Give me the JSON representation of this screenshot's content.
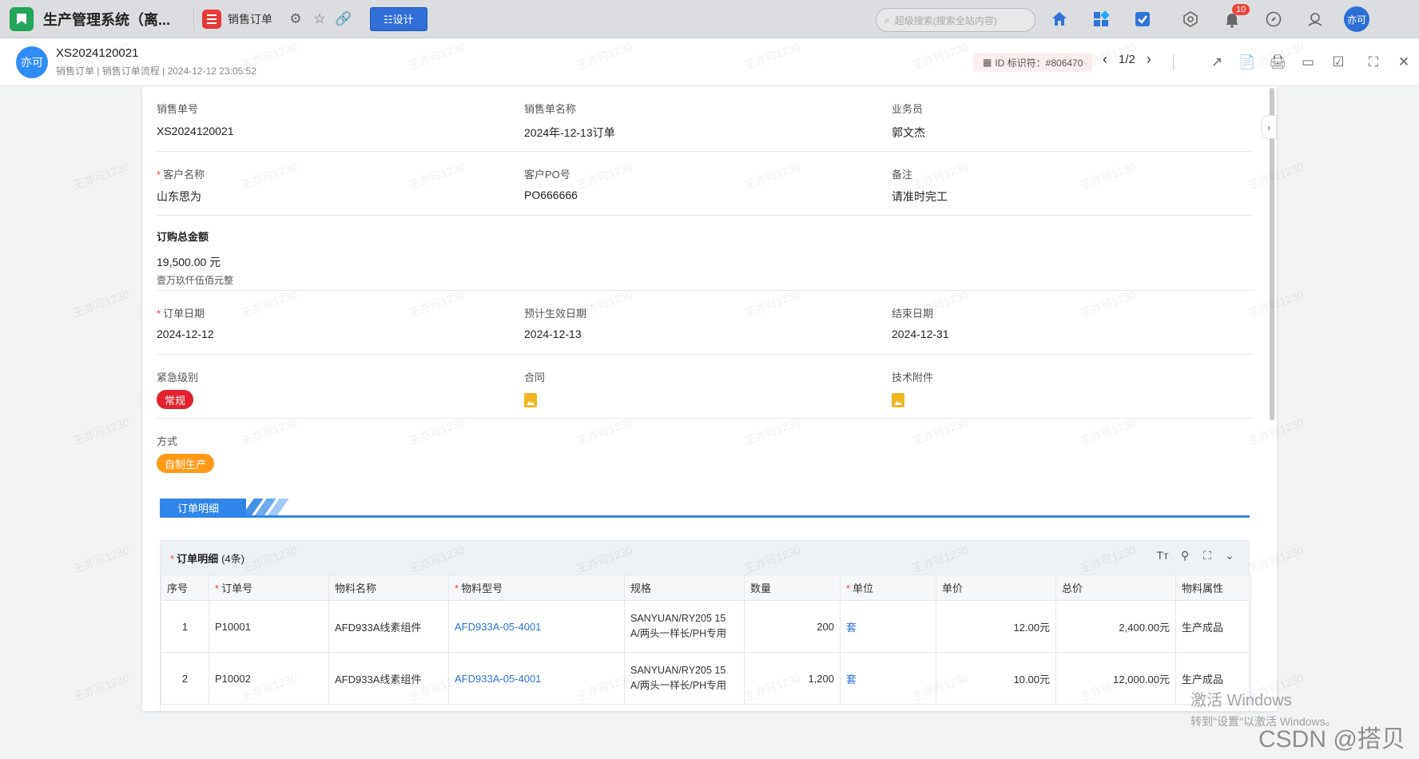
{
  "app": {
    "title": "生产管理系统（离...",
    "tab_title": "销售订单",
    "design_label": "☷设计",
    "search_placeholder": "超级搜索(搜索全站内容)",
    "notification_count": "10",
    "user_avatar": "亦可"
  },
  "record": {
    "avatar": "亦可",
    "title": "XS2024120021",
    "subtitle": "销售订单 | 销售订单流程 | 2024-12-12 23:05:52",
    "id_tag": "ID 标识符：#806470",
    "pager": "1/2"
  },
  "fields": {
    "order_no": {
      "label": "销售单号",
      "value": "XS2024120021"
    },
    "order_name": {
      "label": "销售单名称",
      "value": "2024年-12-13订单"
    },
    "salesman": {
      "label": "业务员",
      "value": "郭文杰"
    },
    "customer": {
      "label": "客户名称",
      "value": "山东思为"
    },
    "customer_po": {
      "label": "客户PO号",
      "value": "PO666666"
    },
    "remark": {
      "label": "备注",
      "value": "请准时完工"
    },
    "total": {
      "label": "订购总金额",
      "value": "19,500.00 元",
      "words": "壹万玖仟伍佰元整"
    },
    "order_date": {
      "label": "订单日期",
      "value": "2024-12-12"
    },
    "effective_date": {
      "label": "预计生效日期",
      "value": "2024-12-13"
    },
    "end_date": {
      "label": "结束日期",
      "value": "2024-12-31"
    },
    "urgency": {
      "label": "紧急级别",
      "value": "常规",
      "color": "#e5202f"
    },
    "contract": {
      "label": "合同"
    },
    "attachment": {
      "label": "技术附件"
    },
    "method": {
      "label": "方式",
      "value": "自制生产",
      "color": "#ff9a19"
    }
  },
  "section": {
    "label": "订单明细"
  },
  "detail_table": {
    "title": "订单明细",
    "count": "(4条)",
    "columns": [
      "序号",
      "订单号",
      "物料名称",
      "物料型号",
      "规格",
      "数量",
      "单位",
      "单价",
      "总价",
      "物料属性"
    ],
    "rows": [
      {
        "seq": "1",
        "order": "P10001",
        "material": "AFD933A线素组件",
        "model": "AFD933A-05-4001",
        "spec1": "SANYUAN/RY205 15",
        "spec2": "A/两头一样长/PH专用",
        "qty": "200",
        "unit": "套",
        "price": "12.00元",
        "total": "2,400.00元",
        "attr": "生产成品"
      },
      {
        "seq": "2",
        "order": "P10002",
        "material": "AFD933A线素组件",
        "model": "AFD933A-05-4001",
        "spec1": "SANYUAN/RY205 15",
        "spec2": "A/两头一样长/PH专用",
        "qty": "1,200",
        "unit": "套",
        "price": "10.00元",
        "total": "12,000.00元",
        "attr": "生产成品"
      }
    ]
  },
  "overlay": {
    "watermark": "王亦可1230",
    "win_activate_1": "激活 Windows",
    "win_activate_2": "转到\"设置\"以激活 Windows。",
    "csdn": "CSDN @搭贝"
  }
}
